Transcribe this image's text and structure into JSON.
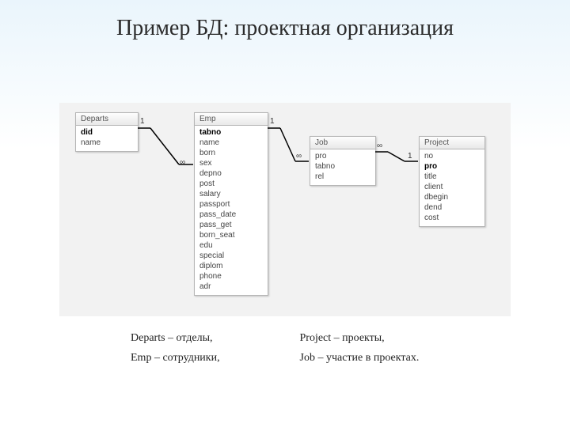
{
  "title": "Пример БД: проектная организация",
  "tables": {
    "departs": {
      "name": "Departs",
      "fields": [
        "did",
        "name"
      ],
      "bold": [
        0
      ]
    },
    "emp": {
      "name": "Emp",
      "fields": [
        "tabno",
        "name",
        "born",
        "sex",
        "depno",
        "post",
        "salary",
        "passport",
        "pass_date",
        "pass_get",
        "born_seat",
        "edu",
        "special",
        "diplom",
        "phone",
        "adr"
      ],
      "bold": [
        0
      ]
    },
    "job": {
      "name": "Job",
      "fields": [
        "pro",
        "tabno",
        "rel"
      ],
      "bold": []
    },
    "project": {
      "name": "Project",
      "fields": [
        "no",
        "pro",
        "title",
        "client",
        "dbegin",
        "dend",
        "cost"
      ],
      "bold": [
        1
      ]
    }
  },
  "relations": {
    "r1": {
      "left": "1",
      "right": "∞"
    },
    "r2": {
      "left": "1",
      "right": "∞"
    },
    "r3": {
      "left": "∞",
      "right": "1"
    }
  },
  "legend": {
    "l1": "Departs – отделы,",
    "l2": "Emp – сотрудники,",
    "l3": "Project – проекты,",
    "l4": "Job – участие в проектах."
  }
}
